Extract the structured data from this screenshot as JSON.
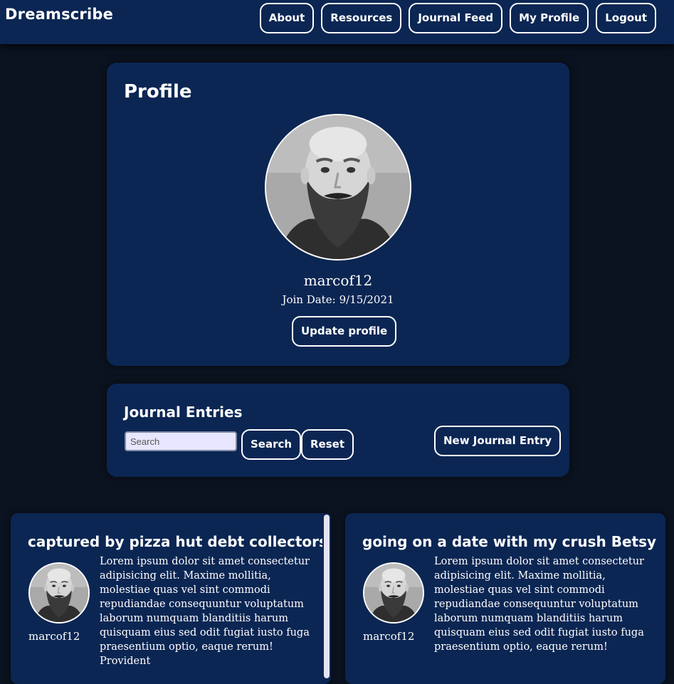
{
  "navbar": {
    "brand": "Dreamscribe",
    "links": [
      "About",
      "Resources",
      "Journal Feed",
      "My Profile",
      "Logout"
    ]
  },
  "profile": {
    "title": "Profile",
    "username": "marcof12",
    "join_date_label": "Join Date:",
    "join_date": "9/15/2021",
    "update_button": "Update profile"
  },
  "journal": {
    "title": "Journal Entries",
    "search_placeholder": "Search",
    "search_button": "Search",
    "reset_button": "Reset",
    "new_entry_button": "New Journal Entry"
  },
  "entries": [
    {
      "title": "captured by pizza hut debt collectors",
      "author": "marcof12",
      "body": "Lorem ipsum dolor sit amet consectetur adipisicing elit. Maxime mollitia, molestiae quas vel sint commodi repudiandae consequuntur voluptatum laborum numquam blanditiis harum quisquam eius sed odit fugiat iusto fuga praesentium optio, eaque rerum! Provident"
    },
    {
      "title": "going on a date with my crush Betsy",
      "author": "marcof12",
      "body": "Lorem ipsum dolor sit amet consectetur adipisicing elit. Maxime mollitia, molestiae quas vel sint commodi repudiandae consequuntur voluptatum laborum numquam blanditiis harum quisquam eius sed odit fugiat iusto fuga praesentium optio, eaque rerum!"
    }
  ],
  "colors": {
    "page_background": "#0b1320",
    "card_background": "#0b2653",
    "text": "#ffffff",
    "search_field": "#e8e7ff"
  }
}
